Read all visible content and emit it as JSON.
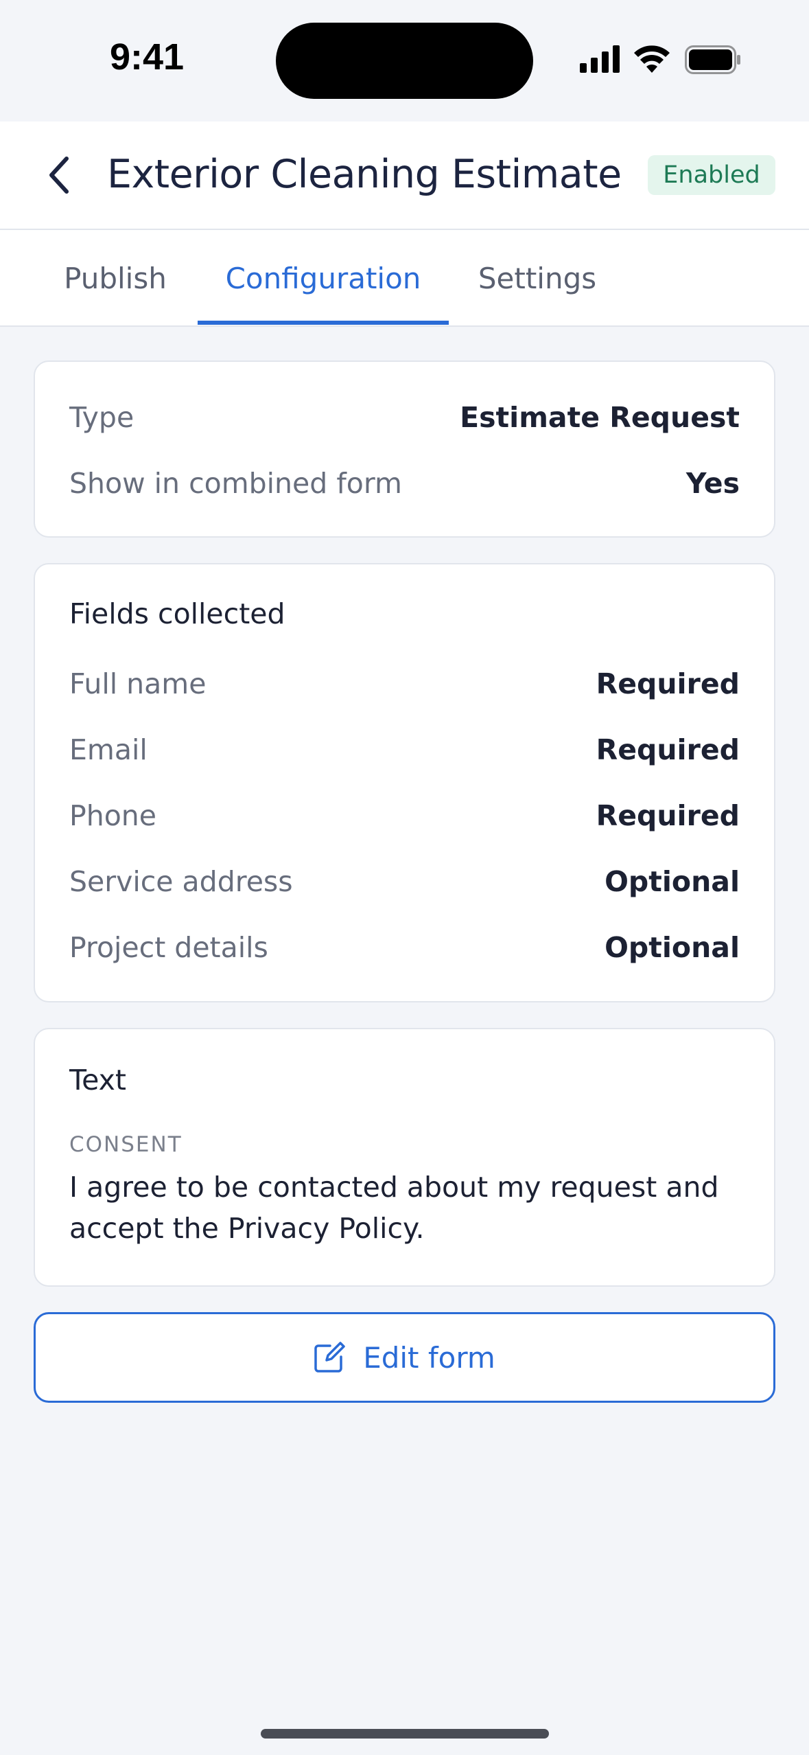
{
  "status_bar": {
    "time": "9:41"
  },
  "header": {
    "title": "Exterior Cleaning Estimate",
    "badge": "Enabled"
  },
  "tabs": [
    {
      "label": "Publish"
    },
    {
      "label": "Configuration"
    },
    {
      "label": "Settings"
    }
  ],
  "active_tab": "Configuration",
  "summary": {
    "rows": [
      {
        "label": "Type",
        "value": "Estimate Request"
      },
      {
        "label": "Show in combined form",
        "value": "Yes"
      }
    ]
  },
  "fields": {
    "heading": "Fields collected",
    "rows": [
      {
        "label": "Full name",
        "value": "Required"
      },
      {
        "label": "Email",
        "value": "Required"
      },
      {
        "label": "Phone",
        "value": "Required"
      },
      {
        "label": "Service address",
        "value": "Optional"
      },
      {
        "label": "Project details",
        "value": "Optional"
      }
    ]
  },
  "text_section": {
    "heading": "Text",
    "consent_label": "CONSENT",
    "consent_text": "I agree to be contacted about my request and accept the Privacy Policy."
  },
  "edit_button": {
    "label": "Edit form",
    "icon": "edit-icon"
  },
  "colors": {
    "accent": "#2a6bd6",
    "badge_bg": "#e4f5ed",
    "badge_text": "#1d7a55",
    "background": "#f3f5f9"
  }
}
